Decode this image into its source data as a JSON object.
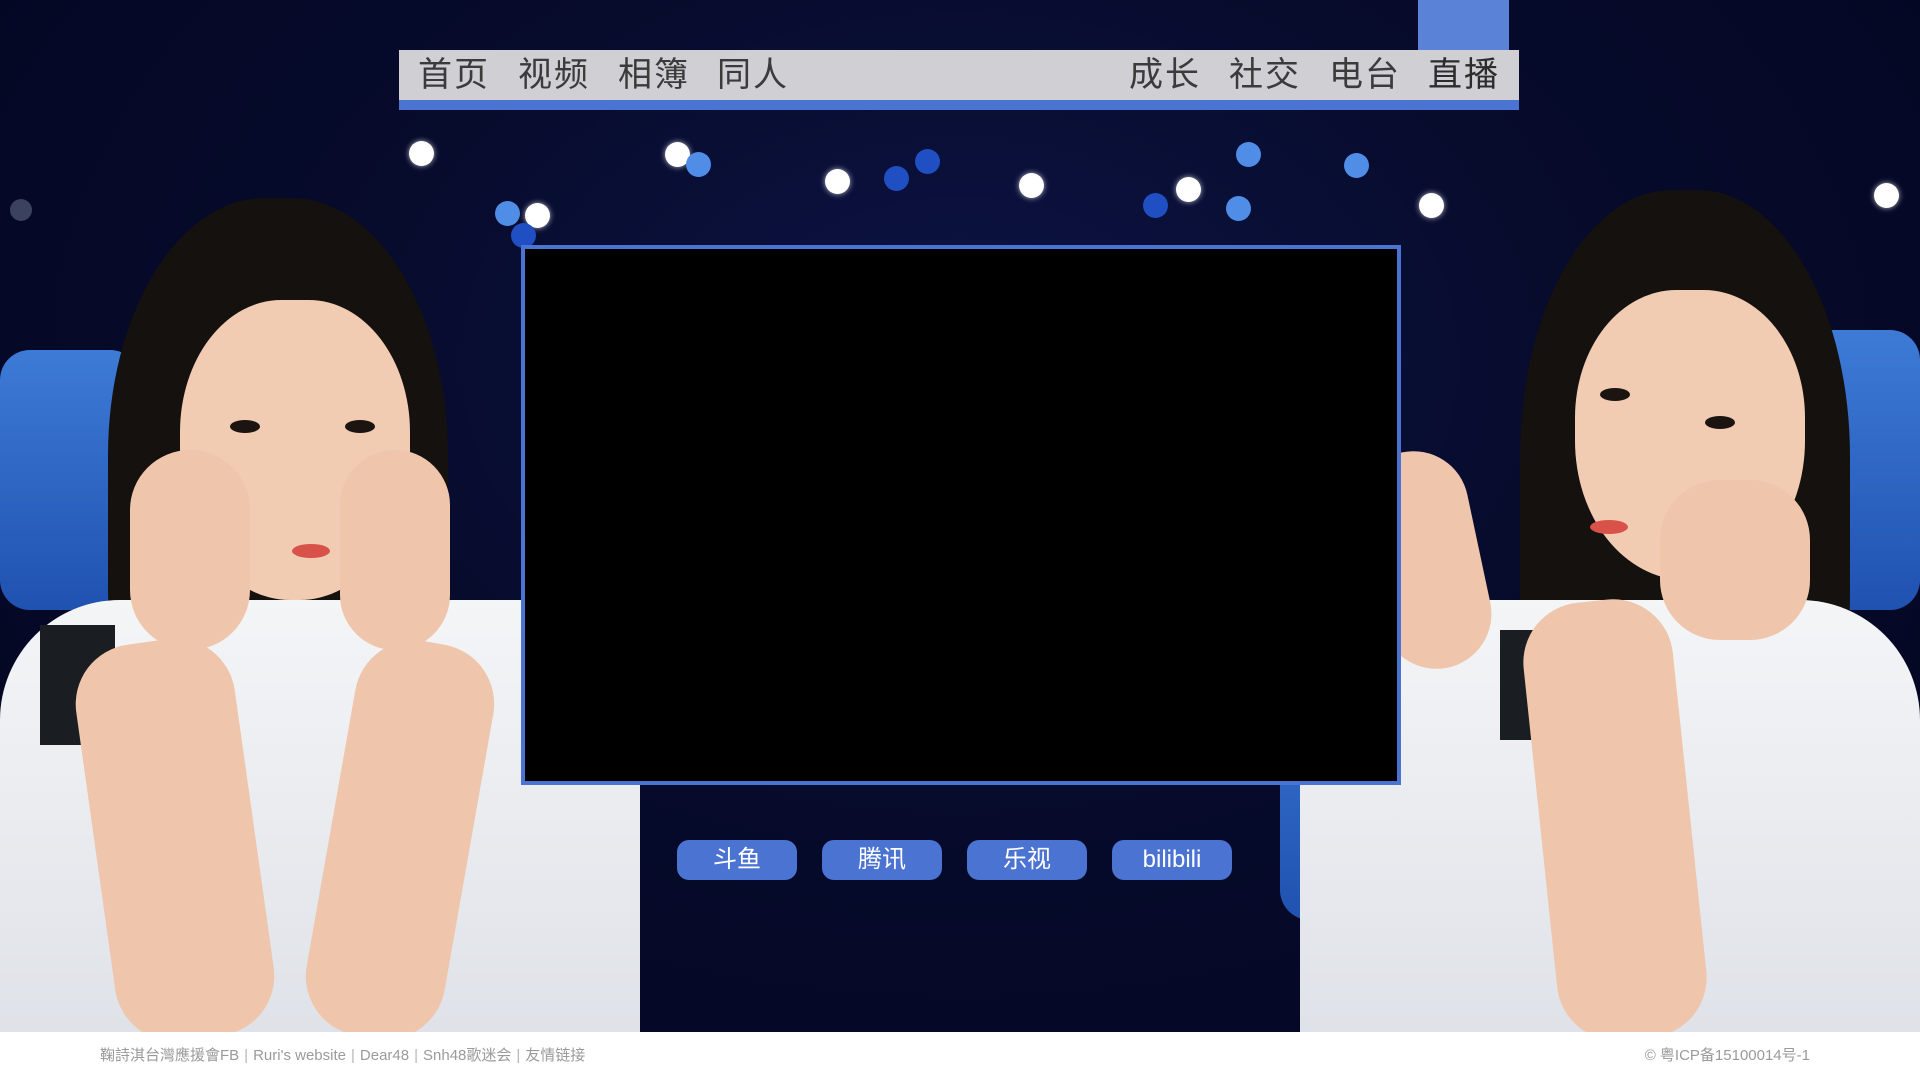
{
  "nav": {
    "left_items": [
      {
        "label": "首页"
      },
      {
        "label": "视频"
      },
      {
        "label": "相簿"
      },
      {
        "label": "同人"
      }
    ],
    "right_items": [
      {
        "label": "成长"
      },
      {
        "label": "社交"
      },
      {
        "label": "电台"
      },
      {
        "label": "直播",
        "active": true
      }
    ]
  },
  "platforms": [
    {
      "label": "斗鱼"
    },
    {
      "label": "腾讯"
    },
    {
      "label": "乐视"
    },
    {
      "label": "bilibili"
    }
  ],
  "footer": {
    "links": [
      {
        "label": "鞠詩淇台灣應援會FB"
      },
      {
        "label": "Ruri's website"
      },
      {
        "label": "Dear48"
      },
      {
        "label": "Snh48歌迷会"
      },
      {
        "label": "友情链接"
      }
    ],
    "separator": "|",
    "icp": "© 粤ICP备15100014号-1"
  },
  "colors": {
    "accent": "#4a73d2",
    "nav_bg": "#cfcfd4",
    "background": "#070b2c",
    "video_bg": "#000000"
  }
}
